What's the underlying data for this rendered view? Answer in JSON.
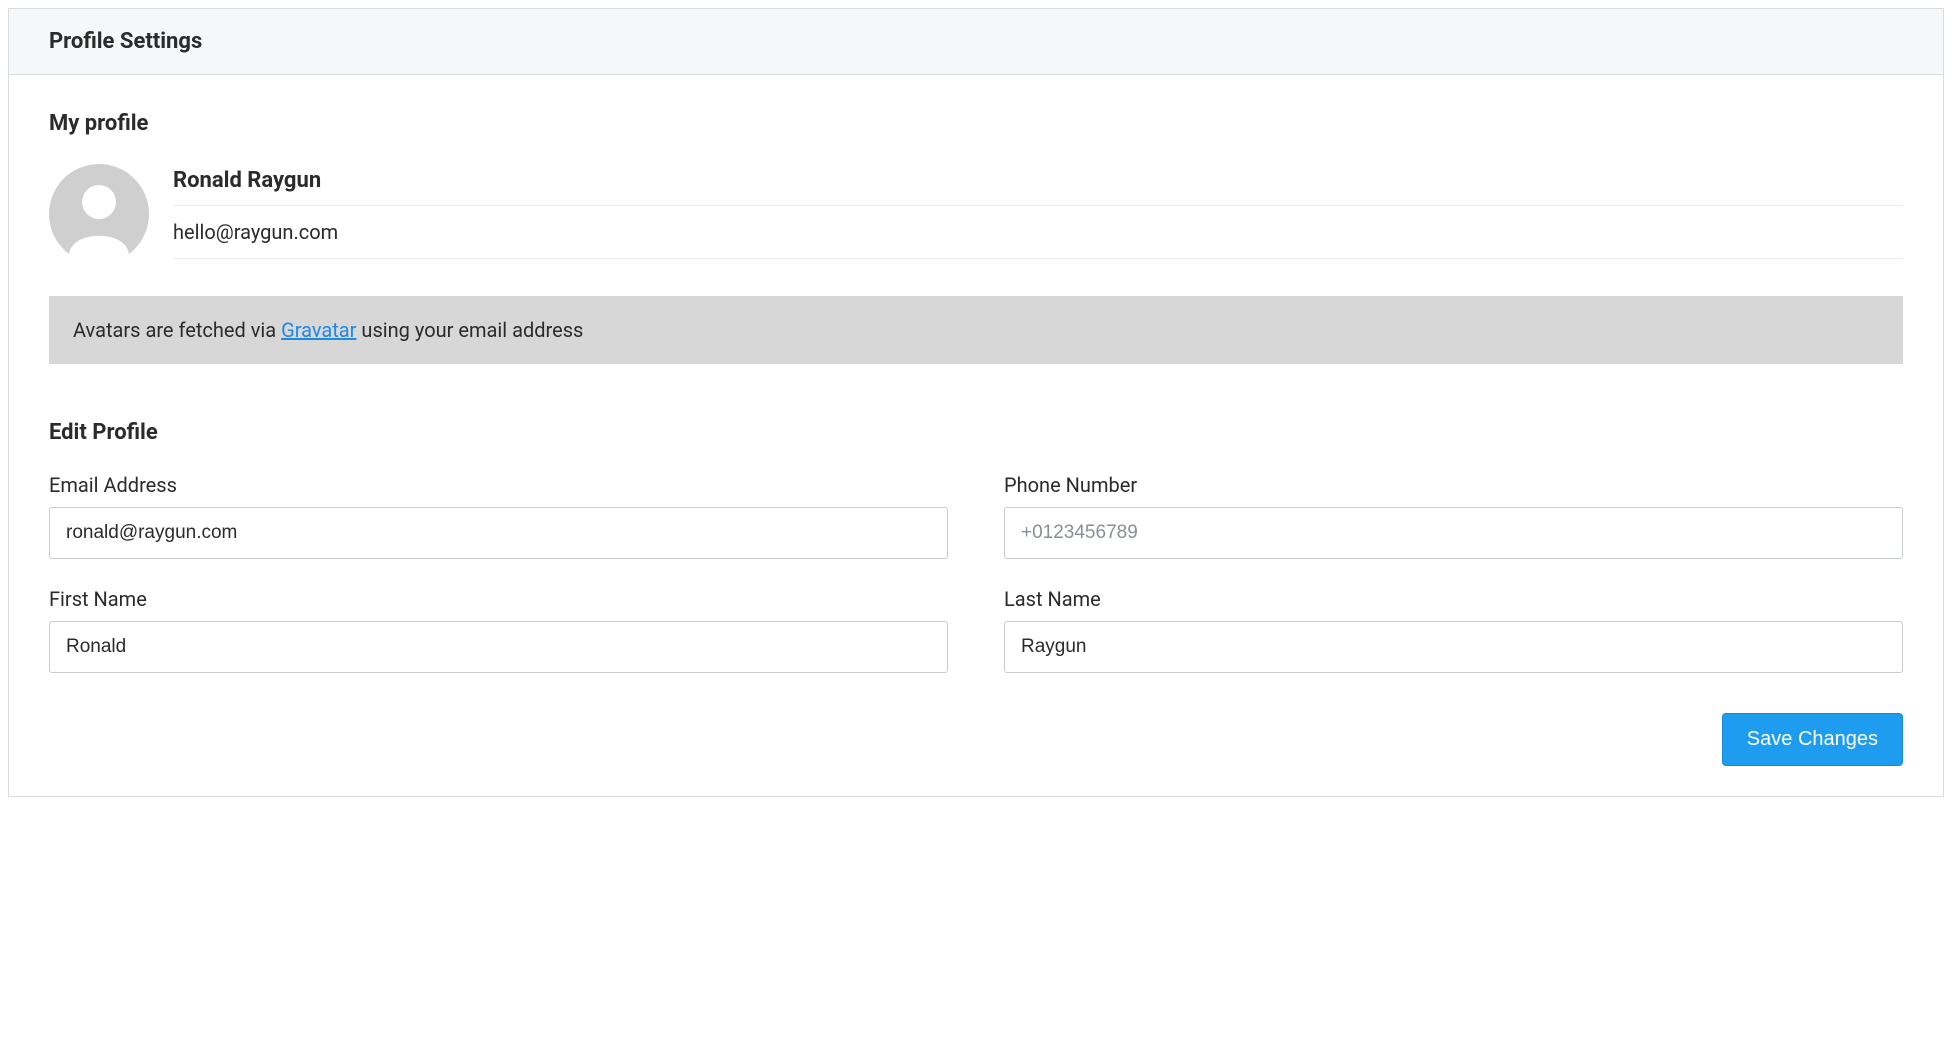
{
  "header": {
    "title": "Profile Settings"
  },
  "profile": {
    "section_title": "My profile",
    "name": "Ronald Raygun",
    "email": "hello@raygun.com"
  },
  "notice": {
    "prefix": "Avatars are fetched via ",
    "link_text": "Gravatar",
    "suffix": " using your email address"
  },
  "edit": {
    "section_title": "Edit Profile",
    "email_label": "Email Address",
    "email_value": "ronald@raygun.com",
    "phone_label": "Phone Number",
    "phone_placeholder": "+0123456789",
    "phone_value": "",
    "first_name_label": "First Name",
    "first_name_value": "Ronald",
    "last_name_label": "Last Name",
    "last_name_value": "Raygun"
  },
  "actions": {
    "save_label": "Save Changes"
  }
}
